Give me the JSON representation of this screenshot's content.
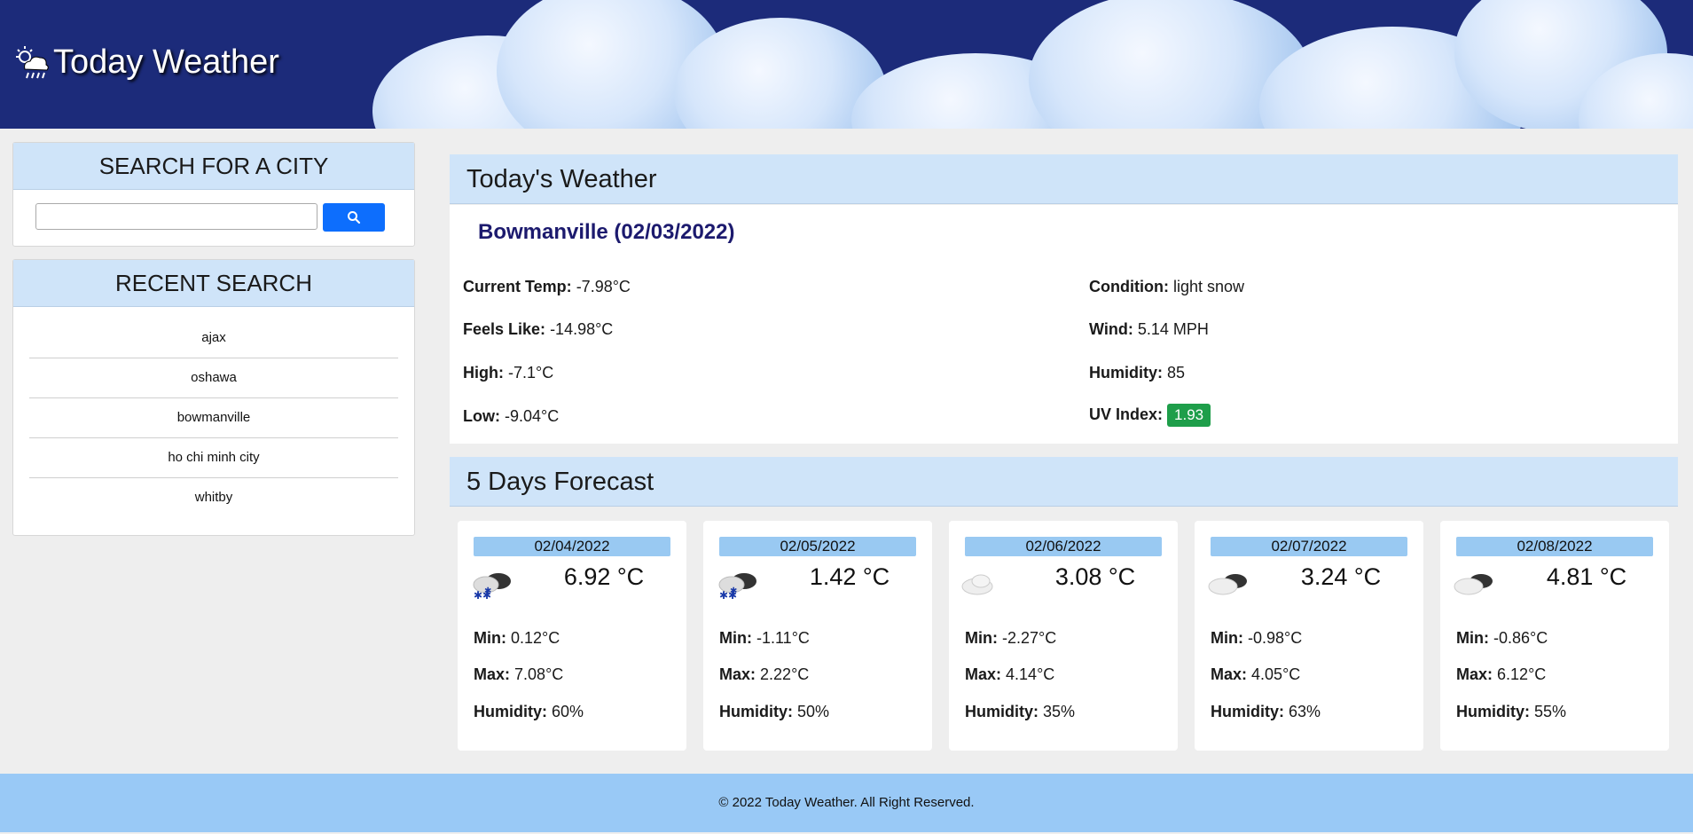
{
  "header": {
    "title": "Today Weather",
    "icon": "weather-cloud-sun-rain-icon"
  },
  "search": {
    "title": "SEARCH FOR A CITY",
    "input_value": "",
    "placeholder": "",
    "button_icon": "search-icon"
  },
  "recent": {
    "title": "RECENT SEARCH",
    "items": [
      "ajax",
      "oshawa",
      "bowmanville",
      "ho chi minh city",
      "whitby"
    ]
  },
  "today": {
    "heading": "Today's Weather",
    "city": "Bowmanville (02/03/2022)",
    "current_temp": {
      "label": "Current Temp:",
      "value": "-7.98°C"
    },
    "feels_like": {
      "label": "Feels Like:",
      "value": "-14.98°C"
    },
    "high": {
      "label": "High:",
      "value": "-7.1°C"
    },
    "low": {
      "label": "Low:",
      "value": "-9.04°C"
    },
    "condition": {
      "label": "Condition:",
      "value": "light snow"
    },
    "wind": {
      "label": "Wind:",
      "value": "5.14 MPH"
    },
    "humidity": {
      "label": "Humidity:",
      "value": "85"
    },
    "uv": {
      "label": "UV Index:",
      "value": "1.93",
      "color": "#1e9e4a"
    }
  },
  "forecast": {
    "heading": "5 Days Forecast",
    "labels": {
      "min": "Min:",
      "max": "Max:",
      "humidity": "Humidity:"
    },
    "days": [
      {
        "date": "02/04/2022",
        "temp": "6.92 °C",
        "icon": "snow-cloud-icon",
        "min": "0.12°C",
        "max": "7.08°C",
        "humidity": "60%"
      },
      {
        "date": "02/05/2022",
        "temp": "1.42 °C",
        "icon": "snow-cloud-icon",
        "min": "-1.11°C",
        "max": "2.22°C",
        "humidity": "50%"
      },
      {
        "date": "02/06/2022",
        "temp": "3.08 °C",
        "icon": "cloud-icon",
        "min": "-2.27°C",
        "max": "4.14°C",
        "humidity": "35%"
      },
      {
        "date": "02/07/2022",
        "temp": "3.24 °C",
        "icon": "broken-clouds-icon",
        "min": "-0.98°C",
        "max": "4.05°C",
        "humidity": "63%"
      },
      {
        "date": "02/08/2022",
        "temp": "4.81 °C",
        "icon": "broken-clouds-icon",
        "min": "-0.86°C",
        "max": "6.12°C",
        "humidity": "55%"
      }
    ]
  },
  "footer": {
    "text": "© 2022 Today Weather. All Right Reserved."
  },
  "colors": {
    "header_bg": "#1c2b7a",
    "panel_head_bg": "#cfe4f9",
    "accent_blue": "#0d6efd",
    "footer_bg": "#99c9f6",
    "city_title": "#1c1a6e"
  }
}
